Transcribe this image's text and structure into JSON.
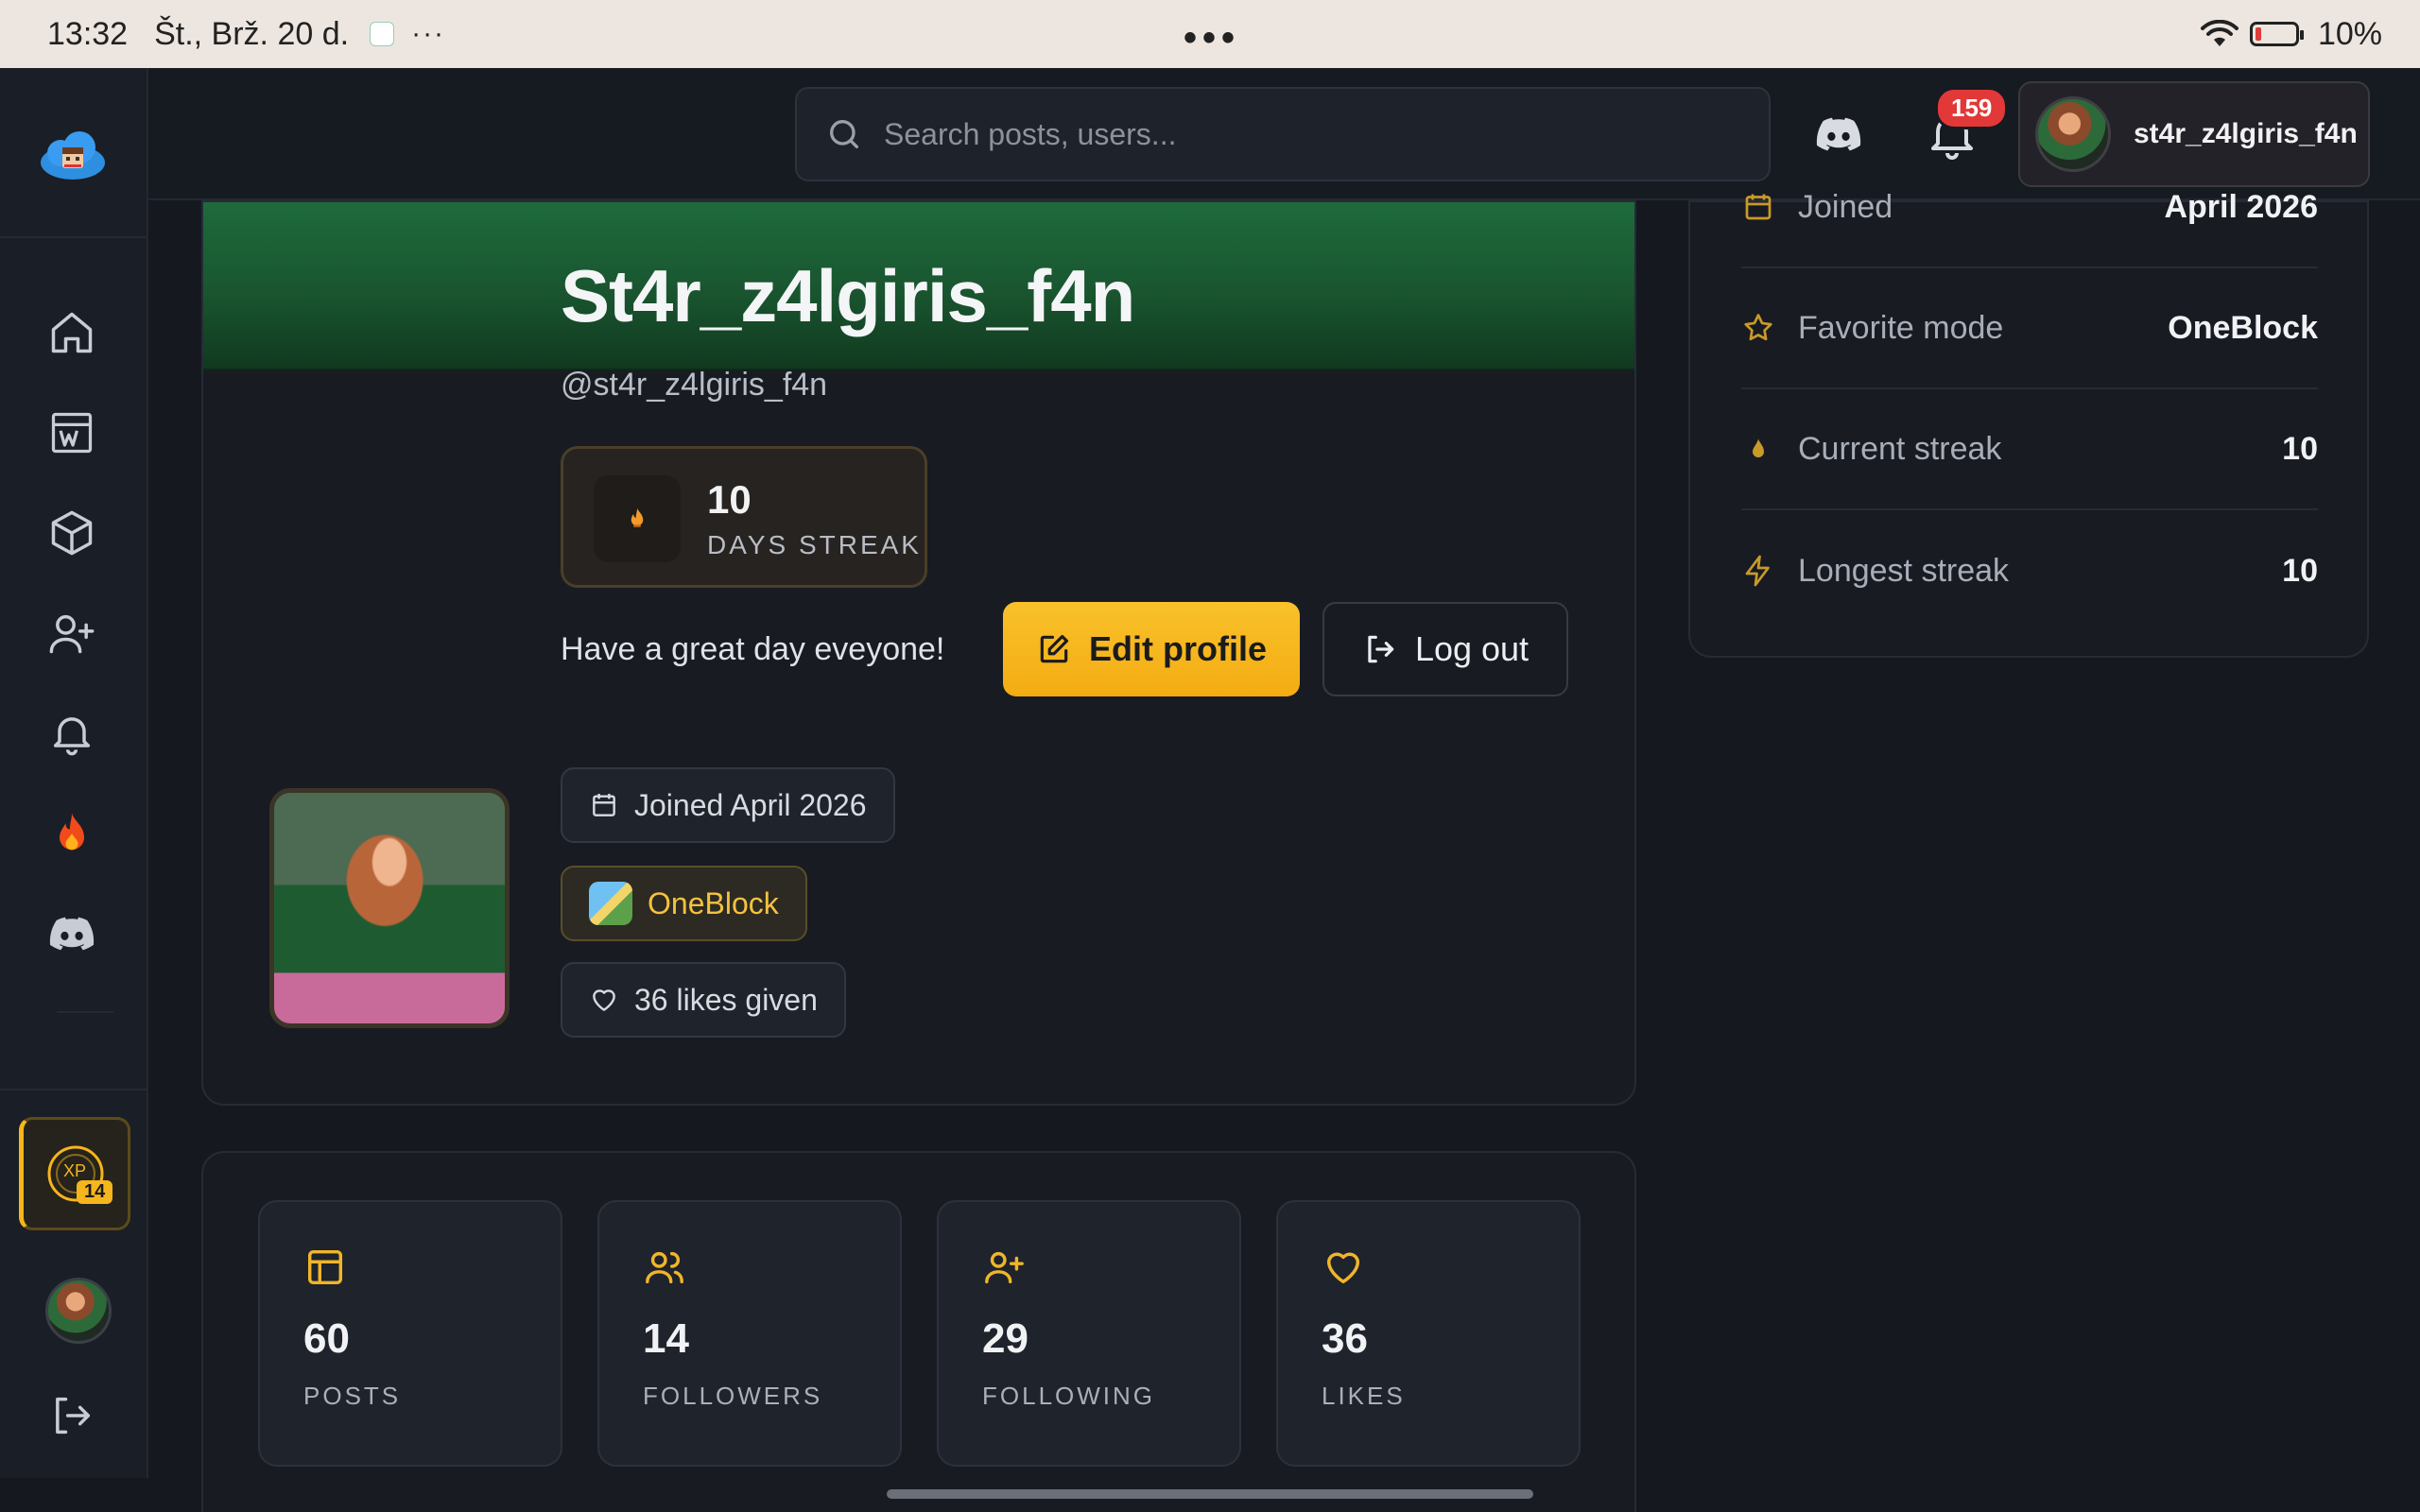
{
  "status_bar": {
    "time": "13:32",
    "date": "Št., Brž. 20 d.",
    "more": "···",
    "battery": "10%"
  },
  "topbar": {
    "search_placeholder": "Search posts, users...",
    "notification_count": "159",
    "username": "st4r_z4lgiris_f4n"
  },
  "sidebar": {
    "xp_label": "XP",
    "xp_level": "14",
    "items": [
      "home",
      "wiki",
      "blocks",
      "add-friend",
      "notifications",
      "hot",
      "discord"
    ]
  },
  "profile": {
    "display_name": "St4r_z4lgiris_f4n",
    "handle": "@st4r_z4lgiris_f4n",
    "streak_count": "10",
    "streak_label": "DAYS STREAK",
    "bio": "Have a great day eveyone!",
    "edit_label": "Edit profile",
    "logout_label": "Log out",
    "joined_chip": "Joined April 2026",
    "mode_chip": "OneBlock",
    "likes_chip": "36 likes given"
  },
  "stats": [
    {
      "value": "60",
      "label": "POSTS"
    },
    {
      "value": "14",
      "label": "FOLLOWERS"
    },
    {
      "value": "29",
      "label": "FOLLOWING"
    },
    {
      "value": "36",
      "label": "LIKES"
    }
  ],
  "details": [
    {
      "key": "Joined",
      "value": "April 2026"
    },
    {
      "key": "Favorite mode",
      "value": "OneBlock"
    },
    {
      "key": "Current streak",
      "value": "10"
    },
    {
      "key": "Longest streak",
      "value": "10"
    }
  ],
  "colors": {
    "accent": "#f5b51c",
    "banner": "#1e6b3c",
    "background": "#15181f",
    "badge": "#e23838"
  }
}
